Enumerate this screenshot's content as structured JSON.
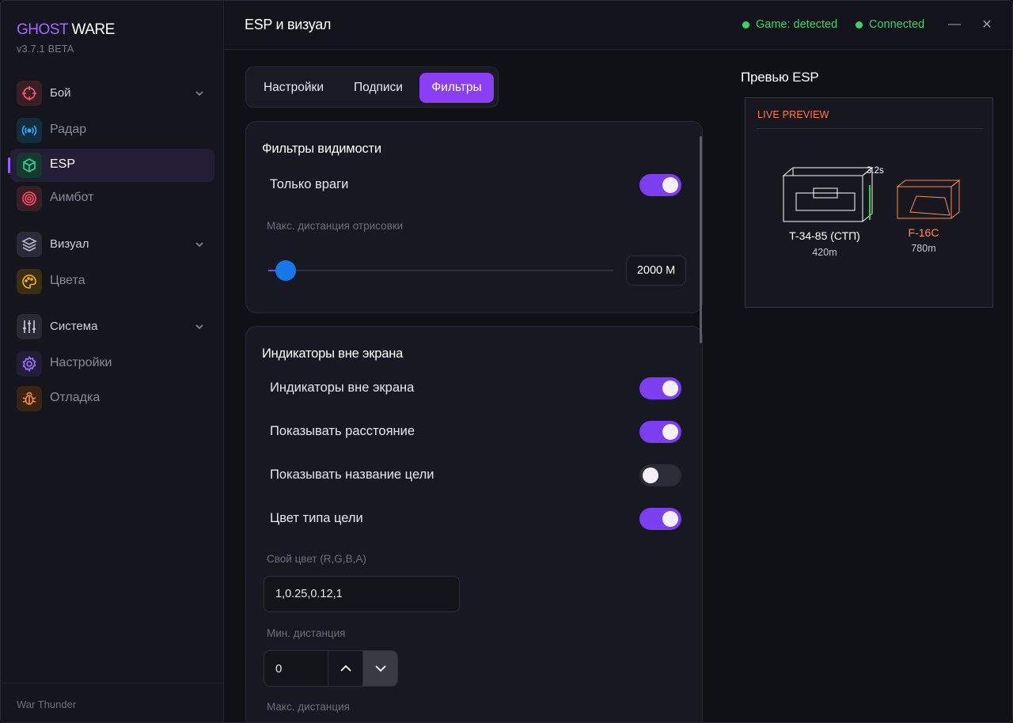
{
  "app": {
    "brand_ghost": "GHOST",
    "brand_ware": "WARE",
    "version": "v3.7.1 BETA",
    "game": "War Thunder",
    "accent": "#8b3ff5"
  },
  "sidebar": {
    "items": [
      {
        "label": "Бой",
        "icon": "crosshair-icon",
        "type": "group",
        "color": "#ff5a6a"
      },
      {
        "label": "Радар",
        "icon": "radar-icon",
        "type": "item",
        "color": "#2ba8ff"
      },
      {
        "label": "ESP",
        "icon": "cube-icon",
        "type": "item",
        "active": true,
        "color": "#2ad49b"
      },
      {
        "label": "Аимбот",
        "icon": "target-icon",
        "type": "item",
        "color": "#ff4a6a"
      },
      {
        "label": "Визуал",
        "icon": "layers-icon",
        "type": "group",
        "color": "#a8a8c8"
      },
      {
        "label": "Цвета",
        "icon": "palette-icon",
        "type": "item",
        "color": "#ffb020"
      },
      {
        "label": "Система",
        "icon": "sliders-icon",
        "type": "group",
        "color": "#c8c8d8"
      },
      {
        "label": "Настройки",
        "icon": "gear-icon",
        "type": "item",
        "color": "#a07aff"
      },
      {
        "label": "Отладка",
        "icon": "bug-icon",
        "type": "item",
        "color": "#ff8a3a"
      }
    ]
  },
  "header": {
    "title": "ESP и визуал",
    "status_game": "Game: detected",
    "status_conn": "Connected",
    "minimize": "—",
    "close": "✕"
  },
  "tabs": [
    {
      "label": "Настройки",
      "active": false
    },
    {
      "label": "Подписи",
      "active": false
    },
    {
      "label": "Фильтры",
      "active": true
    }
  ],
  "visibility": {
    "title": "Фильтры видимости",
    "only_enemies": {
      "label": "Только враги",
      "on": true
    },
    "max_draw_label": "Макс. дистанция отрисовки",
    "max_draw_value": "2000 M",
    "max_draw_fraction": 0.05
  },
  "offscreen": {
    "title": "Индикаторы вне экрана",
    "toggles": [
      {
        "label": "Индикаторы вне экрана",
        "on": true
      },
      {
        "label": "Показывать расстояние",
        "on": true
      },
      {
        "label": "Показывать название цели",
        "on": false
      },
      {
        "label": "Цвет типа цели",
        "on": true
      }
    ],
    "custom_color_label": "Свой цвет (R,G,B,A)",
    "custom_color_value": "1,0.25,0.12,1",
    "min_dist_label": "Мин. дистанция",
    "min_dist_value": "0",
    "max_dist_label": "Макс. дистанция"
  },
  "preview": {
    "title": "Превью ESP",
    "live_label": "LIVE PREVIEW",
    "target1": {
      "name": "T-34-85 (СТП)",
      "distance": "420m",
      "timer": "3.2s",
      "color": "#ffffff"
    },
    "target2": {
      "name": "F-16C",
      "distance": "780m",
      "color": "#ff8a4a"
    }
  }
}
